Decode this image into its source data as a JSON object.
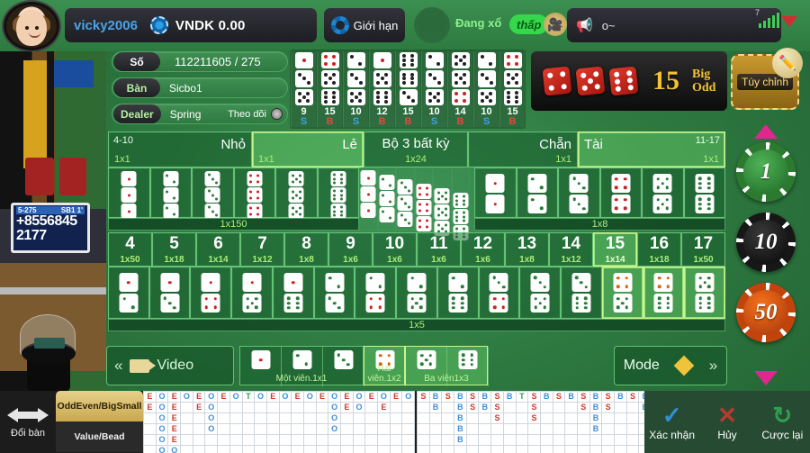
{
  "header": {
    "avatar_name": "player-avatar",
    "username": "vicky2006",
    "currency_balance": "VNDK 0.00",
    "limit_label": "Giới hạn",
    "status_text": "Đang xổ",
    "thap_badge": "thấp",
    "chat_text": "o~",
    "signal_count": "7"
  },
  "info": {
    "so_label": "Số",
    "so_value": "112211605 / 275",
    "ban_label": "Bàn",
    "ban_value": "Sicbo1",
    "dealer_label": "Dealer",
    "dealer_value": "Spring",
    "follow_label": "Theo dõi"
  },
  "video": {
    "board_left": "5-275",
    "board_right": "SB1 1'",
    "board_number": "+8556845",
    "board_number2": "2177"
  },
  "history": [
    {
      "dice": [
        1,
        3,
        5
      ],
      "sum": "9",
      "bs": "S"
    },
    {
      "dice": [
        4,
        5,
        6
      ],
      "sum": "15",
      "bs": "B"
    },
    {
      "dice": [
        2,
        3,
        5
      ],
      "sum": "10",
      "bs": "S"
    },
    {
      "dice": [
        1,
        5,
        6
      ],
      "sum": "12",
      "bs": "B"
    },
    {
      "dice": [
        6,
        6,
        3
      ],
      "sum": "15",
      "bs": "B"
    },
    {
      "dice": [
        2,
        3,
        5
      ],
      "sum": "10",
      "bs": "S"
    },
    {
      "dice": [
        5,
        5,
        4
      ],
      "sum": "14",
      "bs": "B"
    },
    {
      "dice": [
        2,
        3,
        5
      ],
      "sum": "10",
      "bs": "S"
    },
    {
      "dice": [
        4,
        5,
        6
      ],
      "sum": "15",
      "bs": "B"
    }
  ],
  "result": {
    "dice": [
      4,
      5,
      6
    ],
    "sum": "15",
    "tag_top": "Big",
    "tag_bottom": "Odd"
  },
  "custom": {
    "label": "Tùy chỉnh",
    "icon": "pencil-icon"
  },
  "top_row": [
    {
      "name": "Nhỏ",
      "left": "4-10",
      "right": "",
      "odds": "1x1",
      "highlight": false
    },
    {
      "name": "Lẻ",
      "left": "",
      "right": "",
      "odds": "1x1",
      "highlight": true
    },
    {
      "name": "Bộ 3 bất kỳ",
      "left": "",
      "right": "",
      "odds": "1x24",
      "highlight": false
    },
    {
      "name": "Chẵn",
      "left": "",
      "right": "",
      "odds": "1x1",
      "highlight": false
    },
    {
      "name": "Tài",
      "left": "",
      "right": "11-17",
      "odds": "1x1",
      "highlight": true
    }
  ],
  "triples": {
    "odds": "1x150",
    "items": [
      1,
      2,
      3,
      4,
      5,
      6
    ]
  },
  "any_triple": {
    "odds": "1x24",
    "items": [
      1,
      2,
      3,
      4,
      5,
      6
    ]
  },
  "doubles": {
    "odds": "1x8",
    "items": [
      1,
      2,
      3,
      4,
      5,
      6
    ]
  },
  "numbers": [
    {
      "n": "4",
      "odds": "1x50",
      "highlight": false
    },
    {
      "n": "5",
      "odds": "1x18",
      "highlight": false
    },
    {
      "n": "6",
      "odds": "1x14",
      "highlight": false
    },
    {
      "n": "7",
      "odds": "1x12",
      "highlight": false
    },
    {
      "n": "8",
      "odds": "1x8",
      "highlight": false
    },
    {
      "n": "9",
      "odds": "1x6",
      "highlight": false
    },
    {
      "n": "10",
      "odds": "1x6",
      "highlight": false
    },
    {
      "n": "11",
      "odds": "1x6",
      "highlight": false
    },
    {
      "n": "12",
      "odds": "1x6",
      "highlight": false
    },
    {
      "n": "13",
      "odds": "1x8",
      "highlight": false
    },
    {
      "n": "14",
      "odds": "1x12",
      "highlight": false
    },
    {
      "n": "15",
      "odds": "1x14",
      "highlight": true
    },
    {
      "n": "16",
      "odds": "1x18",
      "highlight": false
    },
    {
      "n": "17",
      "odds": "1x50",
      "highlight": false
    }
  ],
  "pairs": {
    "odds": "1x5",
    "items": [
      {
        "d": [
          1,
          2
        ],
        "highlight": false
      },
      {
        "d": [
          1,
          3
        ],
        "highlight": false
      },
      {
        "d": [
          1,
          4
        ],
        "highlight": false
      },
      {
        "d": [
          1,
          5
        ],
        "highlight": false
      },
      {
        "d": [
          1,
          6
        ],
        "highlight": false
      },
      {
        "d": [
          2,
          3
        ],
        "highlight": false
      },
      {
        "d": [
          2,
          4
        ],
        "highlight": false
      },
      {
        "d": [
          2,
          5
        ],
        "highlight": false
      },
      {
        "d": [
          2,
          6
        ],
        "highlight": false
      },
      {
        "d": [
          3,
          4
        ],
        "highlight": false
      },
      {
        "d": [
          3,
          5
        ],
        "highlight": false
      },
      {
        "d": [
          3,
          6
        ],
        "highlight": false
      },
      {
        "d": [
          4,
          5
        ],
        "highlight": true
      },
      {
        "d": [
          4,
          6
        ],
        "highlight": true
      },
      {
        "d": [
          5,
          6
        ],
        "highlight": true
      }
    ]
  },
  "bottom": {
    "video_label": "Video",
    "mode_label": "Mode",
    "groups": [
      {
        "label": "Một viên.1x1",
        "dice": [
          1,
          2,
          3
        ],
        "highlight": false
      },
      {
        "label": "Hai viên.1x2",
        "dice": [
          4
        ],
        "highlight": true
      },
      {
        "label": "Ba viên1x3",
        "dice": [
          5,
          6
        ],
        "highlight": true
      }
    ]
  },
  "roadmap": {
    "swap_label": "Đổi bàn",
    "tab_active": "OddEven/BigSmall",
    "tab_idle": "Value/Bead",
    "oddeven": [
      [
        "E",
        "E",
        "",
        "",
        "",
        ""
      ],
      [
        "O",
        "O",
        "O",
        "O",
        "O",
        "O"
      ],
      [
        "E",
        "E",
        "E",
        "E",
        "E",
        "O"
      ],
      [
        "O",
        "",
        "",
        "",
        "",
        ""
      ],
      [
        "E",
        "E",
        "",
        "",
        "",
        ""
      ],
      [
        "O",
        "O",
        "O",
        "O",
        "",
        ""
      ],
      [
        "E",
        "",
        "",
        "",
        "",
        ""
      ],
      [
        "O",
        "",
        "",
        "",
        "",
        ""
      ],
      [
        "T",
        "",
        "",
        "",
        "",
        ""
      ],
      [
        "O",
        "",
        "",
        "",
        "",
        ""
      ],
      [
        "E",
        "",
        "",
        "",
        "",
        ""
      ],
      [
        "O",
        "",
        "",
        "",
        "",
        ""
      ],
      [
        "E",
        "",
        "",
        "",
        "",
        ""
      ],
      [
        "O",
        "",
        "",
        "",
        "",
        ""
      ],
      [
        "E",
        "",
        "",
        "",
        "",
        ""
      ],
      [
        "O",
        "O",
        "O",
        "O",
        "",
        ""
      ],
      [
        "E",
        "E",
        "",
        "",
        "",
        ""
      ],
      [
        "O",
        "O",
        "",
        "",
        "",
        ""
      ],
      [
        "E",
        "",
        "",
        "",
        "",
        ""
      ],
      [
        "O",
        "E",
        "",
        "",
        "",
        ""
      ],
      [
        "E",
        "",
        "",
        "",
        "",
        ""
      ],
      [
        "O",
        "",
        "",
        "",
        "",
        ""
      ]
    ],
    "bigsmall": [
      [
        "S",
        "",
        "",
        "",
        "",
        ""
      ],
      [
        "B",
        "B",
        "",
        "",
        "",
        ""
      ],
      [
        "S",
        "",
        "",
        "",
        "",
        ""
      ],
      [
        "B",
        "B",
        "B",
        "B",
        "B",
        ""
      ],
      [
        "S",
        "S",
        "",
        "",
        "",
        ""
      ],
      [
        "B",
        "B",
        "",
        "",
        "",
        ""
      ],
      [
        "S",
        "S",
        "S",
        "",
        "",
        ""
      ],
      [
        "B",
        "",
        "",
        "",
        "",
        ""
      ],
      [
        "T",
        "",
        "",
        "",
        "",
        ""
      ],
      [
        "S",
        "S",
        "S",
        "",
        "",
        ""
      ],
      [
        "B",
        "",
        "",
        "",
        "",
        ""
      ],
      [
        "S",
        "",
        "",
        "",
        "",
        ""
      ],
      [
        "B",
        "",
        "",
        "",
        "",
        ""
      ],
      [
        "S",
        "S",
        "",
        "",
        "",
        ""
      ],
      [
        "B",
        "B",
        "B",
        "B",
        "",
        ""
      ],
      [
        "S",
        "S",
        "",
        "",
        "",
        ""
      ],
      [
        "B",
        "",
        "",
        "",
        "",
        ""
      ],
      [
        "S",
        "",
        "",
        "",
        "",
        ""
      ],
      [
        "B",
        "B",
        "",
        "",
        "",
        ""
      ],
      [
        "S",
        "",
        "",
        "",
        "",
        ""
      ],
      [
        "B",
        "",
        "",
        "",
        "",
        ""
      ],
      [
        "S",
        "",
        "",
        "",
        "",
        ""
      ],
      [
        "B",
        "",
        "",
        "",
        "",
        ""
      ]
    ]
  },
  "actions": [
    {
      "icon": "check-icon",
      "glyph": "✓",
      "label": "Xác nhận",
      "cls": "check"
    },
    {
      "icon": "close-icon",
      "glyph": "✕",
      "label": "Hủy",
      "cls": "x"
    },
    {
      "icon": "redo-icon",
      "glyph": "↻",
      "label": "Cược lại",
      "cls": "redo"
    }
  ]
}
